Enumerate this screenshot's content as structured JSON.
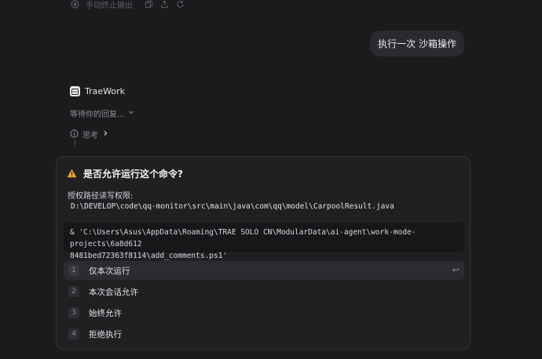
{
  "top_bar": {
    "stop_label": "手动终止输出",
    "icons": [
      "stop-circle-icon",
      "copy-icon",
      "share-icon",
      "refresh-icon"
    ]
  },
  "user_message": {
    "text": "执行一次 沙箱操作"
  },
  "assistant": {
    "name": "TraeWork",
    "status": "等待你的回复...",
    "thinking_label": "思考"
  },
  "permission_dialog": {
    "title": "是否允许运行这个命令?",
    "permission_label": "授权路径读写权限:",
    "path": "D:\\DEVELOP\\code\\qq-monitor\\src\\main\\java\\com\\qq\\model\\CarpoolResult.java",
    "command_line1": "& 'C:\\Users\\Asus\\AppData\\Roaming\\TRAE SOLO CN\\ModularData\\ai-agent\\work-mode-projects\\6a8d612",
    "command_line2": "8481bed72363f8114\\add_comments.ps1'",
    "options": [
      {
        "num": "1",
        "label": "仅本次运行",
        "selected": true
      },
      {
        "num": "2",
        "label": "本次会话允许",
        "selected": false
      },
      {
        "num": "3",
        "label": "始终允许",
        "selected": false
      },
      {
        "num": "4",
        "label": "拒绝执行",
        "selected": false
      }
    ],
    "enter_symbol": "↩"
  },
  "colors": {
    "background": "#1b1b1d",
    "dialog_bg": "#202023",
    "warning": "#f0a52b"
  }
}
